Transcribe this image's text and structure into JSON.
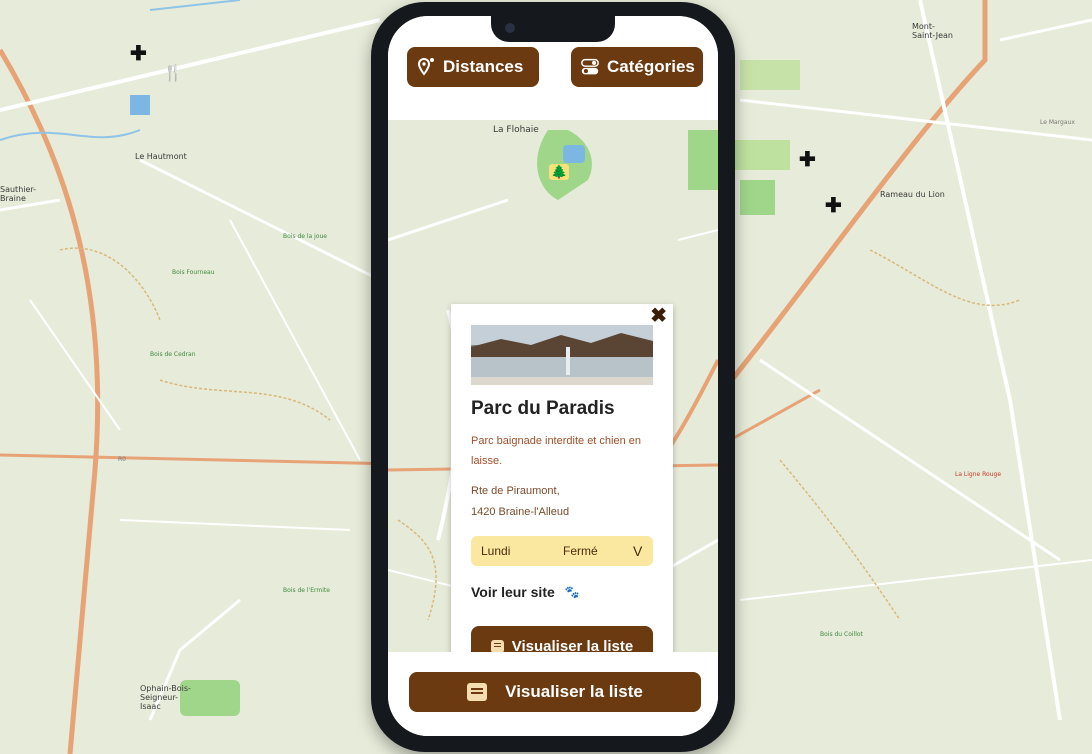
{
  "header": {
    "distances_label": "Distances",
    "categories_label": "Catégories"
  },
  "map_labels": {
    "la_flohaie": "La Flohaie",
    "le_hautmont": "Le Hautmont",
    "mont_saint_jean": "Mont-\nSaint-Jean",
    "ophain_bois": "Ophain-Bois-\nSeigneur-\nIsaac",
    "rameau_du_lion": "Rameau du Lion",
    "le_margaux": "Le Margaux",
    "bois_de_la_joue": "Bois de la joue",
    "bois_de_l_ermite": "Bois de l'Ermite",
    "bois_de_cedran": "Bois de Cedran",
    "bois_du_fourneau": "Bois Fourneau",
    "sauthier_braine": "Sauthier-\nBraine",
    "la_ligne_rouge": "La Ligne Rouge",
    "bois_de_coillot": "Bois du Coillot",
    "r0_label": "R0"
  },
  "popup": {
    "title": "Parc du Paradis",
    "description": "Parc baignade interdite et chien en laisse.",
    "address_line1": "Rte de Piraumont,",
    "address_line2": "1420 Braine-l'Alleud",
    "hours_day": "Lundi",
    "hours_status": "Fermé",
    "hours_chevron": "V",
    "site_label": "Voir leur site",
    "list_button": "Visualiser la liste"
  },
  "bottom": {
    "list_button": "Visualiser la liste"
  },
  "icons": {
    "pin": "location-pin-icon",
    "toggle": "toggle-icon",
    "close": "close-icon",
    "paw": "paw-icon",
    "list": "list-icon",
    "cross": "cross-icon",
    "restaurant": "restaurant-icon",
    "park": "park-icon"
  },
  "colors": {
    "brand_brown": "#6b3a10",
    "hours_bg": "#fbe8a0",
    "map_bg": "#e6ead9"
  }
}
